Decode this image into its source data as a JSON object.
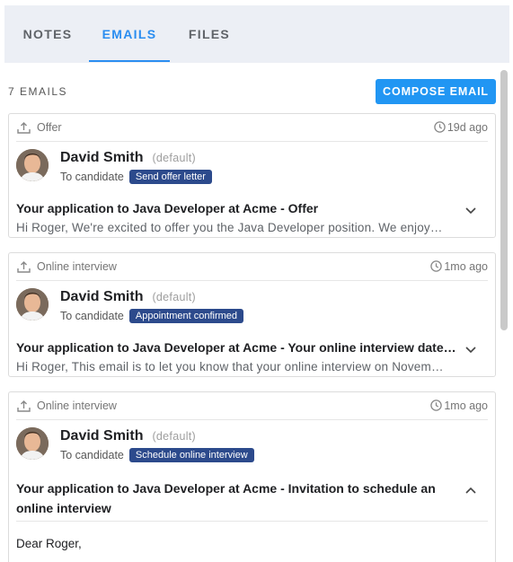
{
  "tabs": [
    {
      "label": "NOTES"
    },
    {
      "label": "EMAILS",
      "active": true
    },
    {
      "label": "FILES"
    }
  ],
  "email_count": "7 EMAILS",
  "compose_label": "COMPOSE EMAIL",
  "accent_color": "#2196f3",
  "badge_color": "#2c4a8c",
  "emails": [
    {
      "stage": "Offer",
      "time": "19d ago",
      "sender": "David Smith",
      "sender_tag": "(default)",
      "to": "To candidate",
      "badge": "Send offer letter",
      "subject": "Your application to Java Developer at Acme - Offer",
      "preview": "Hi Roger, We're excited to offer you the Java Developer position. We enjoyed getting to know you",
      "expanded": false
    },
    {
      "stage": "Online interview",
      "time": "1mo ago",
      "sender": "David Smith",
      "sender_tag": "(default)",
      "to": "To candidate",
      "badge": "Appointment confirmed",
      "subject": "Your application to Java Developer at Acme - Your online interview date has been confirmed",
      "preview": "Hi Roger, This email is to let you know that your online interview on November has been confirmed",
      "expanded": false
    },
    {
      "stage": "Online interview",
      "time": "1mo ago",
      "sender": "David Smith",
      "sender_tag": "(default)",
      "to": "To candidate",
      "badge": "Schedule online interview",
      "subject": "Your application to Java Developer at Acme - Invitation to schedule an online interview",
      "body": "Dear Roger,",
      "expanded": true
    }
  ]
}
